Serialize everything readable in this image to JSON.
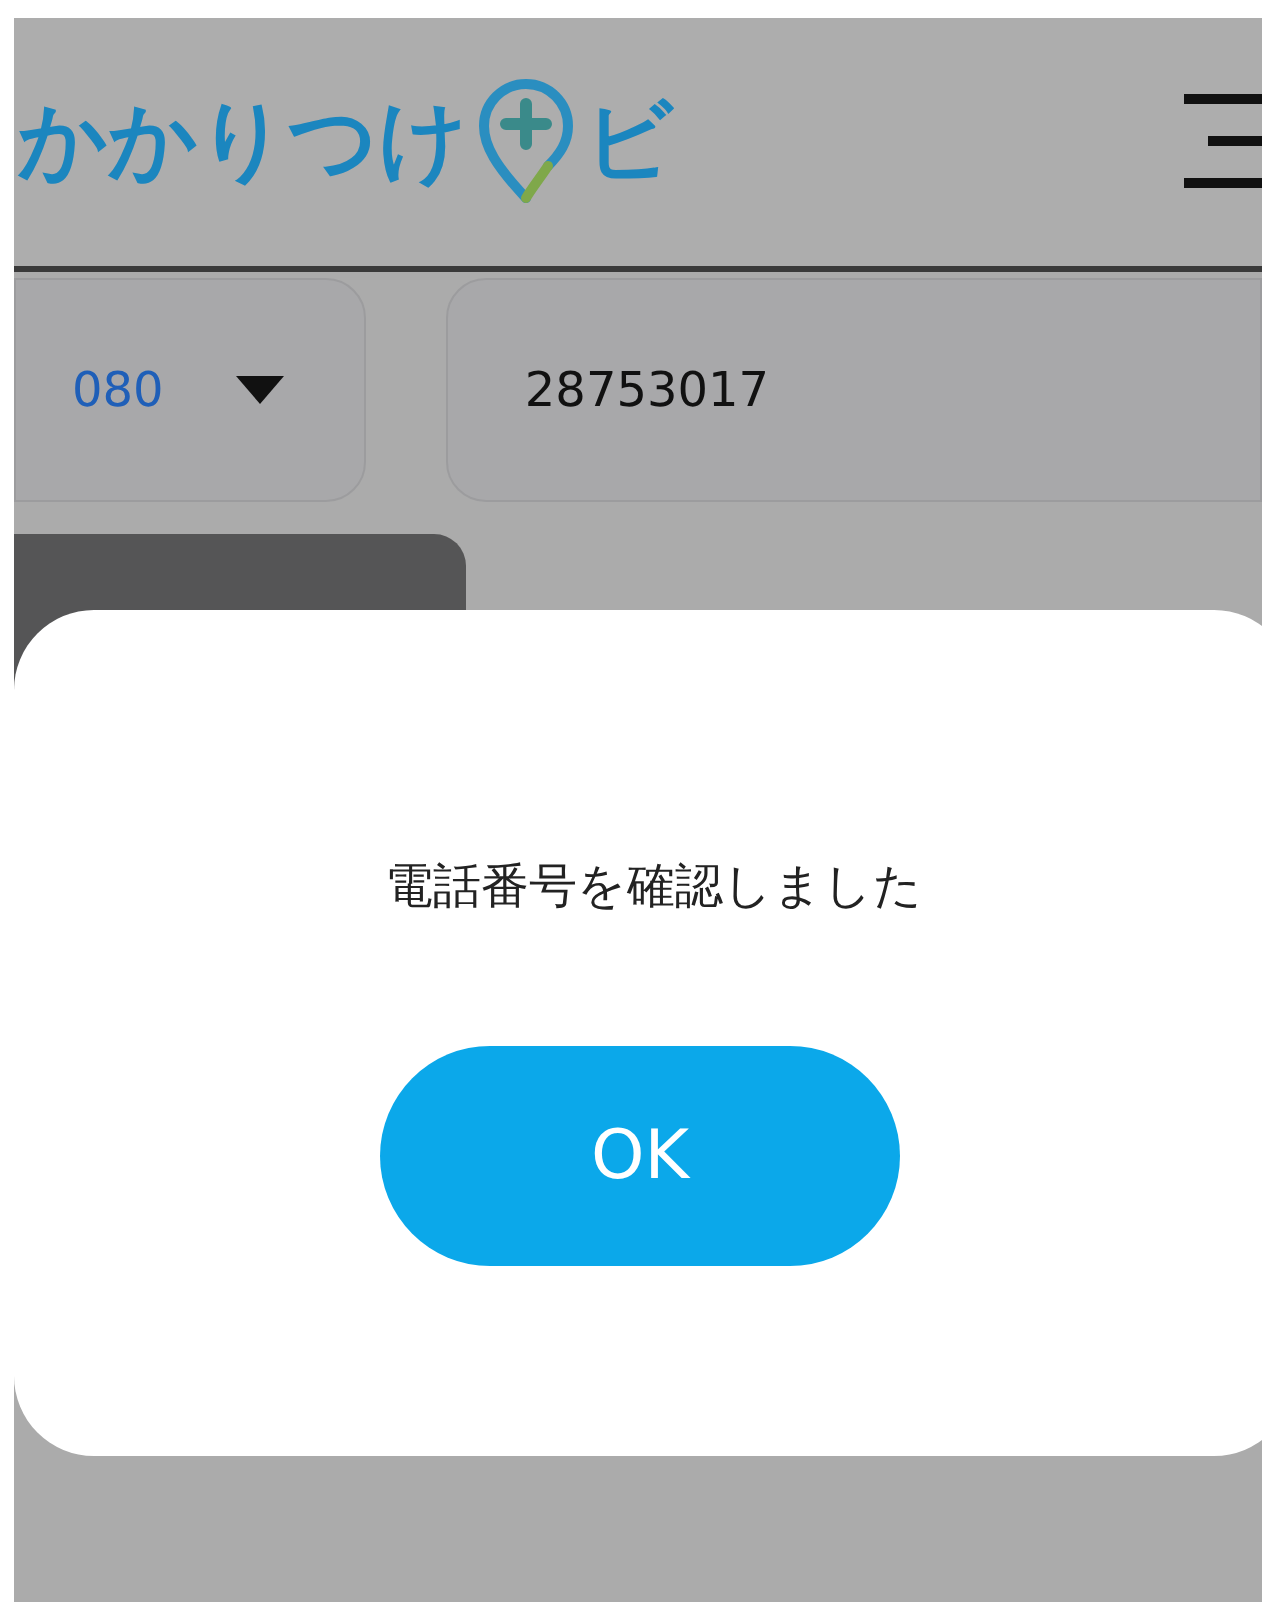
{
  "header": {
    "logo_text": "かかりつけ",
    "logo_suffix": "ビ"
  },
  "phone": {
    "prefix": "080",
    "number": "28753017"
  },
  "dialog": {
    "message": "電話番号を確認しました",
    "button": "OK"
  }
}
